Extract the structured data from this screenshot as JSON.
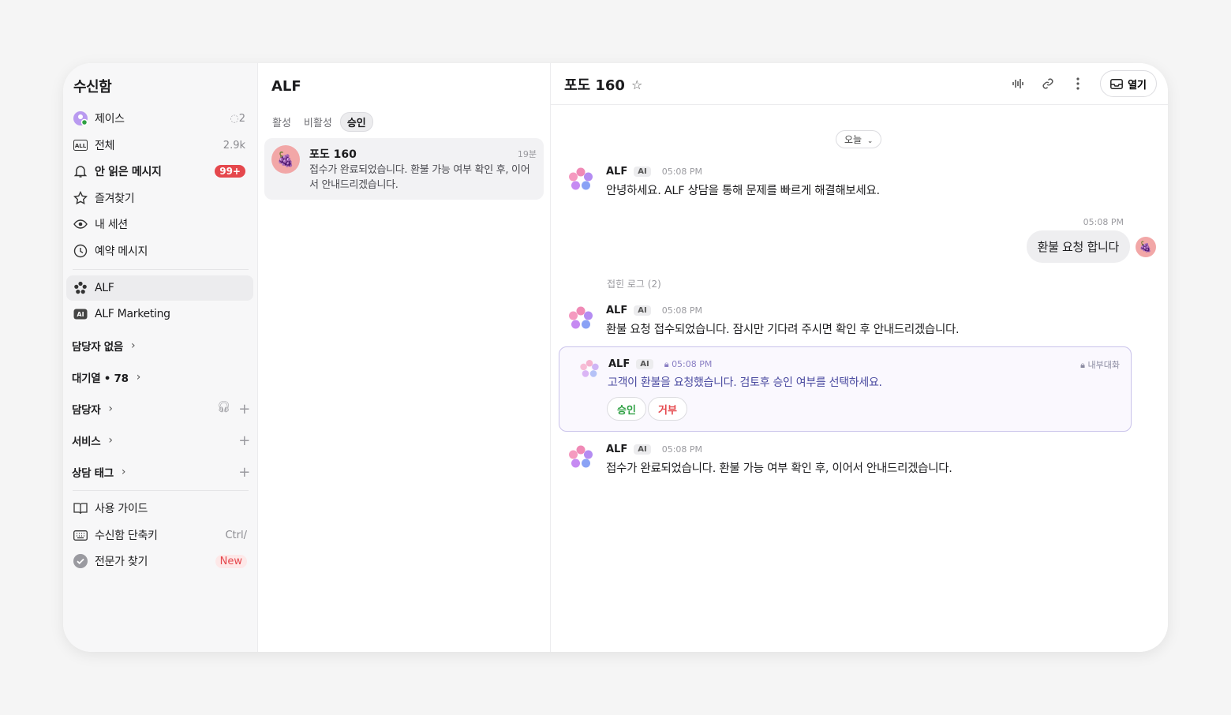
{
  "sidebar": {
    "title": "수신함",
    "items": [
      {
        "label": "제이스",
        "count": "2"
      },
      {
        "label": "전체",
        "count": "2.9k"
      },
      {
        "label": "안 읽은 메시지",
        "badge": "99+"
      },
      {
        "label": "즐겨찾기"
      },
      {
        "label": "내 세션"
      },
      {
        "label": "예약 메시지"
      },
      {
        "label": "ALF"
      },
      {
        "label": "ALF Marketing"
      }
    ],
    "sections": [
      {
        "label": "담당자 없음"
      },
      {
        "label": "대기열 • 78"
      },
      {
        "label": "담당자"
      },
      {
        "label": "서비스"
      },
      {
        "label": "상담 태그"
      }
    ],
    "footer": [
      {
        "label": "사용 가이드"
      },
      {
        "label": "수신함 단축키",
        "shortcut": "Ctrl/"
      },
      {
        "label": "전문가 찾기",
        "badge": "New"
      }
    ]
  },
  "list": {
    "title": "ALF",
    "tabs": [
      "활성",
      "비활성",
      "승인"
    ],
    "chat": {
      "name": "포도 160",
      "time": "19분",
      "preview": "접수가 완료되었습니다. 환불 가능 여부 확인 후, 이어서 안내드리겠습니다."
    }
  },
  "conversation": {
    "title": "포도 160",
    "open_label": "열기",
    "date_label": "오늘",
    "messages": [
      {
        "who": "ALF",
        "tag": "AI",
        "time": "05:08 PM",
        "text": "안녕하세요. ALF 상담을 통해 문제를 빠르게 해결해보세요."
      },
      {
        "who": "ALF",
        "tag": "AI",
        "time": "05:08 PM",
        "text": "환불 요청 접수되었습니다. 잠시만 기다려 주시면 확인 후 안내드리겠습니다."
      },
      {
        "who": "ALF",
        "tag": "AI",
        "time": "05:08 PM",
        "text": "접수가 완료되었습니다. 환불 가능 여부 확인 후, 이어서 안내드리겠습니다."
      }
    ],
    "user_message": {
      "time": "05:08 PM",
      "text": "환불 요청 합니다"
    },
    "folded_log": "접힌 로그 (2)",
    "internal": {
      "who": "ALF",
      "tag": "AI",
      "time": "05:08 PM",
      "label": "내부대화",
      "text": "고객이 환불을 요청했습니다. 검토후 승인 여부를 선택하세요.",
      "approve": "승인",
      "reject": "거부"
    }
  },
  "colors": {
    "accent_red": "#e5484d",
    "approve_green": "#2ea043",
    "internal_border": "#c9c2ea"
  }
}
